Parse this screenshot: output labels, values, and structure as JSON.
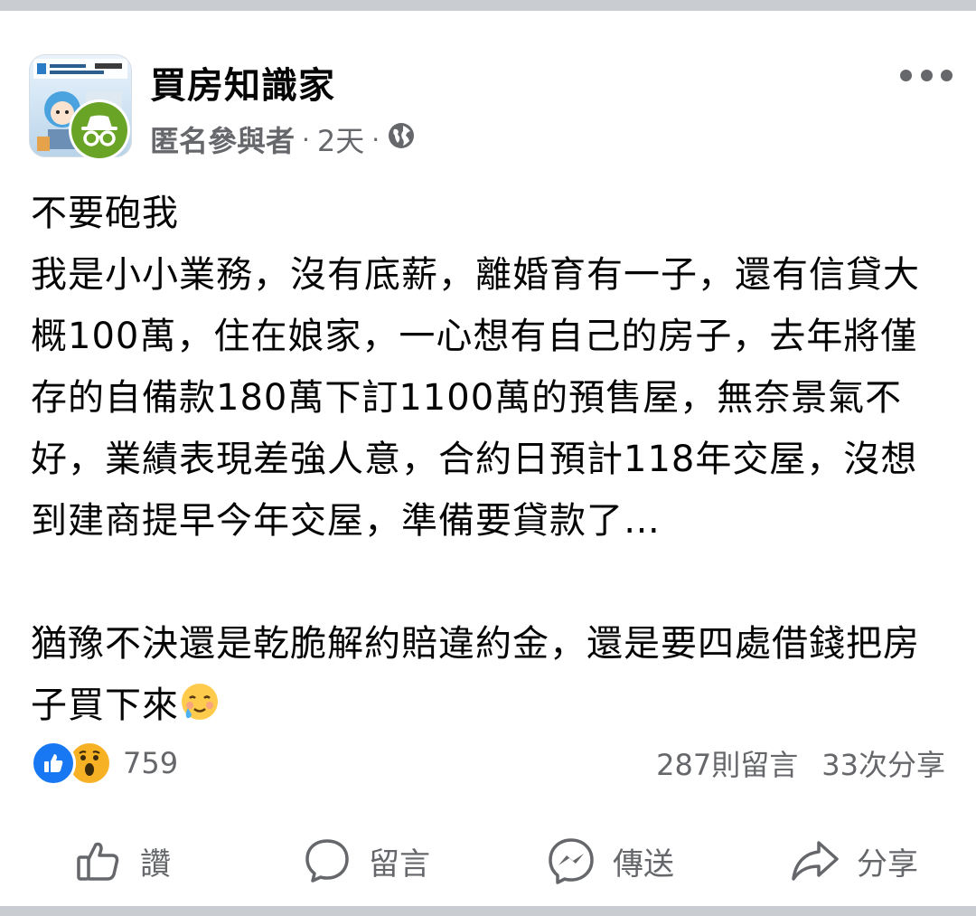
{
  "post": {
    "group_name": "買房知識家",
    "author": "匿名參與者",
    "time": "2天",
    "separator": "·",
    "audience_icon": "globe-icon",
    "paragraphs": [
      "不要砲我",
      "我是小小業務，沒有底薪，離婚育有一子，還有信貸大概100萬，住在娘家，一心想有自己的房子，去年將僅存的自備款180萬下訂1100萬的預售屋，無奈景氣不好，業績表現差強人意，合約日預計118年交屋，沒想到建商提早今年交屋，準備要貸款了…",
      "猶豫不決還是乾脆解約賠違約金，還是要四處借錢把房子買下來"
    ],
    "reaction_count": "759",
    "comments": "287則留言",
    "shares": "33次分享"
  },
  "actions": {
    "like": "讚",
    "comment": "留言",
    "send": "傳送",
    "share": "分享"
  },
  "colors": {
    "like_blue": "#1877f2",
    "wow_yellow": "#f7b125",
    "anon_green": "#6aa427",
    "secondary_text": "#65676b"
  }
}
